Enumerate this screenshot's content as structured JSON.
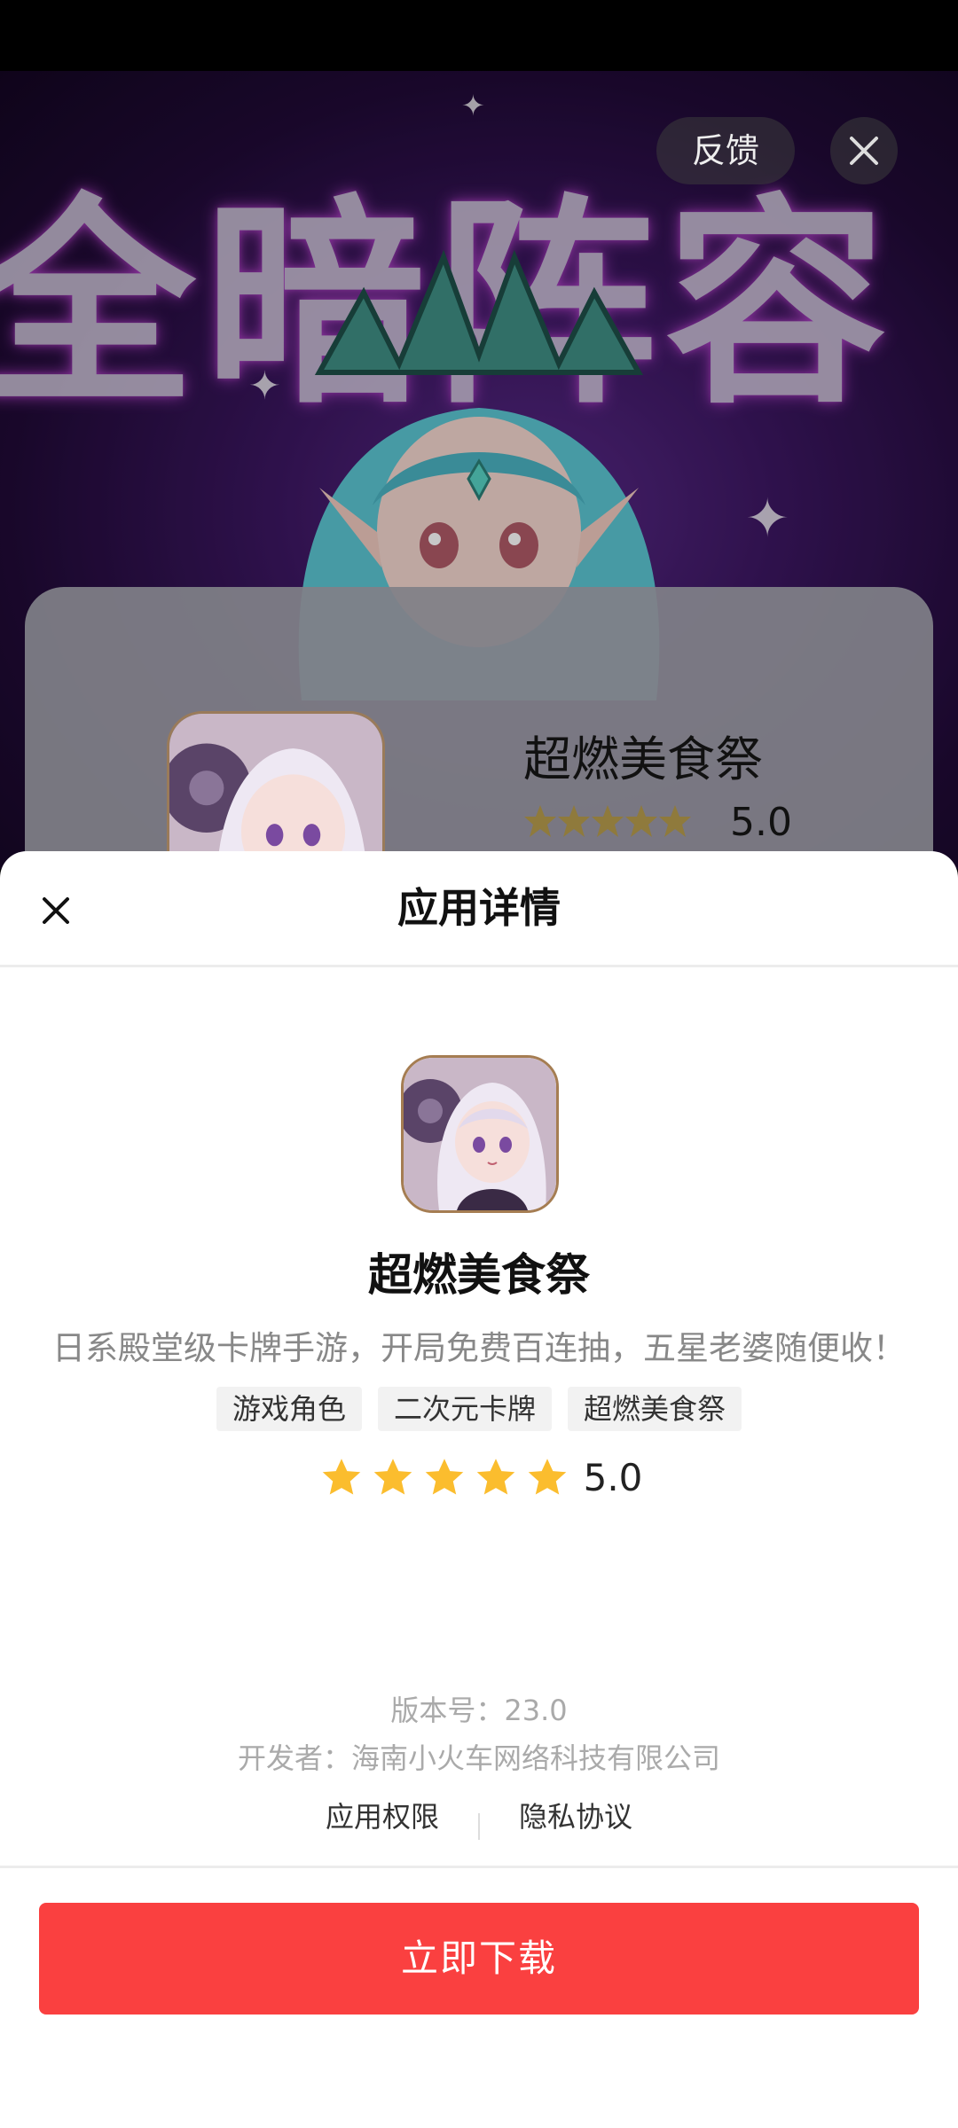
{
  "ad": {
    "banner_text": "全暗阵容",
    "feedback_label": "反馈",
    "card": {
      "app_name": "超燃美食祭",
      "rating": "5.0"
    }
  },
  "sheet": {
    "title": "应用详情",
    "app_name": "超燃美食祭",
    "description": "日系殿堂级卡牌手游，开局免费百连抽，五星老婆随便收！",
    "tags": [
      "游戏角色",
      "二次元卡牌",
      "超燃美食祭"
    ],
    "rating": "5.0",
    "rating_stars": 5,
    "version": "版本号：23.0",
    "developer": "开发者：海南小火车网络科技有限公司",
    "links": {
      "permissions": "应用权限",
      "privacy": "隐私协议"
    },
    "download_label": "立即下载"
  },
  "colors": {
    "accent": "#fa4040",
    "star": "#fbbd2e"
  }
}
